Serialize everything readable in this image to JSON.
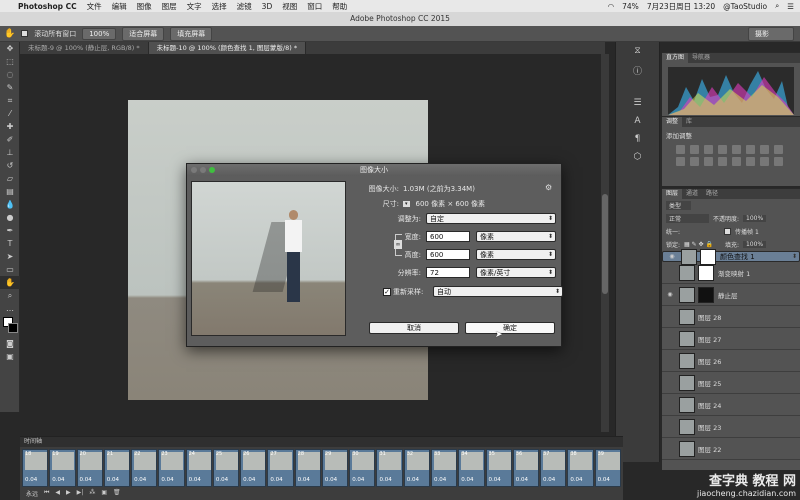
{
  "menubar": {
    "apple": "",
    "app": "Photoshop CC",
    "items": [
      "文件",
      "编辑",
      "图像",
      "图层",
      "文字",
      "选择",
      "滤镜",
      "3D",
      "视图",
      "窗口",
      "帮助"
    ],
    "battery": "74%",
    "clock": "7月23日周日 13:20",
    "user": "@TaoStudio"
  },
  "window": {
    "title": "Adobe Photoshop CC 2015"
  },
  "options": {
    "scroll_all": "滚动所有窗口",
    "zoom_100": "100%",
    "fit_screen": "适合屏幕",
    "fill_screen": "填充屏幕",
    "workspace": "摄影"
  },
  "tabs": [
    {
      "label": "未标题-9 @ 100% (静止层, RGB/8) *"
    },
    {
      "label": "未标题-10 @ 100% (颜色查找 1, 图层蒙版/8) *"
    }
  ],
  "panels": {
    "histogram_tabs": [
      "直方图",
      "导航器"
    ],
    "adjust_tabs": [
      "调整",
      "库"
    ],
    "add_adjust": "添加调整",
    "layers_tabs": [
      "图层",
      "通道",
      "路径"
    ],
    "kind": "类型",
    "blend": "正常",
    "opacity_label": "不透明度:",
    "opacity": "100%",
    "lock_label": "锁定:",
    "fill_label": "填充:",
    "fill": "100%",
    "unify": "统一:",
    "propagate": "传播帧 1",
    "layers": [
      {
        "name": "颜色查找 1",
        "selected": true
      },
      {
        "name": "渐变映射 1",
        "selected": false
      },
      {
        "name": "静止层",
        "selected": false
      },
      {
        "name": "图层 28",
        "selected": false
      },
      {
        "name": "图层 27",
        "selected": false
      },
      {
        "name": "图层 26",
        "selected": false
      },
      {
        "name": "图层 25",
        "selected": false
      },
      {
        "name": "图层 24",
        "selected": false
      },
      {
        "name": "图层 23",
        "selected": false
      },
      {
        "name": "图层 22",
        "selected": false
      }
    ]
  },
  "timeline": {
    "title": "时间轴",
    "frames": [
      {
        "num": "18",
        "dur": "0.04"
      },
      {
        "num": "19",
        "dur": "0.04"
      },
      {
        "num": "20",
        "dur": "0.04"
      },
      {
        "num": "21",
        "dur": "0.04"
      },
      {
        "num": "22",
        "dur": "0.04"
      },
      {
        "num": "23",
        "dur": "0.04"
      },
      {
        "num": "24",
        "dur": "0.04"
      },
      {
        "num": "25",
        "dur": "0.04"
      },
      {
        "num": "26",
        "dur": "0.04"
      },
      {
        "num": "27",
        "dur": "0.04"
      },
      {
        "num": "28",
        "dur": "0.04"
      },
      {
        "num": "29",
        "dur": "0.04"
      },
      {
        "num": "30",
        "dur": "0.04"
      },
      {
        "num": "31",
        "dur": "0.04"
      },
      {
        "num": "32",
        "dur": "0.04"
      },
      {
        "num": "33",
        "dur": "0.04"
      },
      {
        "num": "34",
        "dur": "0.04"
      },
      {
        "num": "35",
        "dur": "0.04"
      },
      {
        "num": "36",
        "dur": "0.04"
      },
      {
        "num": "37",
        "dur": "0.04"
      },
      {
        "num": "38",
        "dur": "0.04"
      },
      {
        "num": "39",
        "dur": "0.04"
      }
    ],
    "loop": "永远"
  },
  "dialog": {
    "title": "图像大小",
    "image_size_label": "图像大小:",
    "image_size": "1.03M (之前为3.34M)",
    "dimensions_label": "尺寸:",
    "dimensions": "600 像素 × 600 像素",
    "fit_label": "调整为:",
    "fit_value": "自定",
    "width_label": "宽度:",
    "width_value": "600",
    "width_unit": "像素",
    "height_label": "高度:",
    "height_value": "600",
    "height_unit": "像素",
    "resolution_label": "分辨率:",
    "resolution_value": "72",
    "resolution_unit": "像素/英寸",
    "resample_label": "重新采样:",
    "resample_value": "自动",
    "cancel": "取消",
    "ok": "确定"
  },
  "watermark": {
    "line1": "查字典 教程 网",
    "line2": "jiaocheng.chazidian.com"
  },
  "colors": {
    "panel": "#535353",
    "selected_layer": "#6a7f96",
    "frame": "#5a7a99"
  }
}
